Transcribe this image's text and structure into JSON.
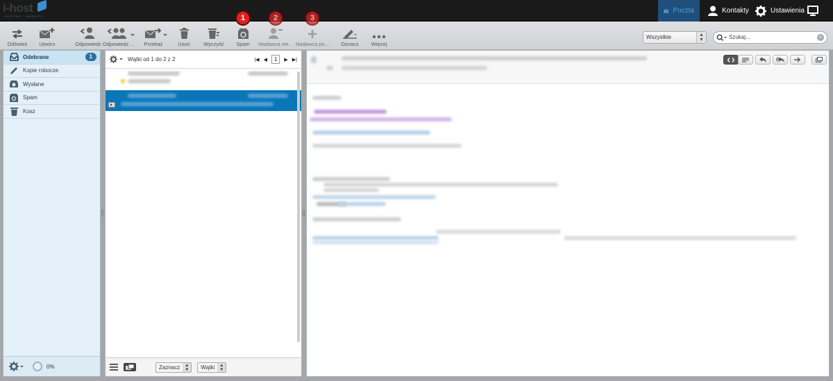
{
  "topbar": {
    "nav": [
      {
        "label": "Poczta",
        "icon": "mail-icon",
        "active": true
      },
      {
        "label": "Kontakty",
        "icon": "person-icon",
        "active": false
      },
      {
        "label": "Ustawienia",
        "icon": "gear-icon",
        "active": false
      }
    ],
    "monitor_icon": "monitor-icon"
  },
  "toolbar": {
    "buttons": [
      {
        "label": "Odśwież",
        "icon": "refresh-icon"
      },
      {
        "label": "Utwórz",
        "icon": "compose-icon"
      },
      {
        "label": "Odpowiedz",
        "icon": "reply-icon"
      },
      {
        "label": "Odpowiedz ...",
        "icon": "reply-all-icon"
      },
      {
        "label": "Przekaż",
        "icon": "forward-icon"
      },
      {
        "label": "Usuń",
        "icon": "trash-icon"
      },
      {
        "label": "Wyczyść",
        "icon": "clear-icon"
      },
      {
        "label": "Spam",
        "icon": "spam-icon",
        "badge": "1"
      },
      {
        "label": "Nadawca nie...",
        "icon": "block-sender-icon",
        "badge": "2"
      },
      {
        "label": "Nadawca po...",
        "icon": "add-sender-icon",
        "badge": "3"
      },
      {
        "label": "Oznacz",
        "icon": "mark-icon"
      },
      {
        "label": "Więcej",
        "icon": "more-icon"
      }
    ],
    "filter_value": "Wszystkie",
    "search_placeholder": "Szukaj..."
  },
  "folders": {
    "items": [
      {
        "label": "Odebrane",
        "icon": "inbox-icon",
        "count": "1",
        "selected": true
      },
      {
        "label": "Kopie robocze",
        "icon": "pencil-icon"
      },
      {
        "label": "Wysłane",
        "icon": "sent-icon"
      },
      {
        "label": "Spam",
        "icon": "spam-icon"
      },
      {
        "label": "Kosz",
        "icon": "trash-icon"
      }
    ],
    "quota": "0%"
  },
  "list": {
    "header": "Wątki od 1 do 2 z 2",
    "page": "1",
    "footer": {
      "select_label": "Zaznacz",
      "threads_label": "Wątki"
    }
  },
  "colors": {
    "accent": "#0a76b8",
    "badge": "#e02020",
    "topbar": "#1a1a1a",
    "active_nav": "#1f4f7a"
  }
}
